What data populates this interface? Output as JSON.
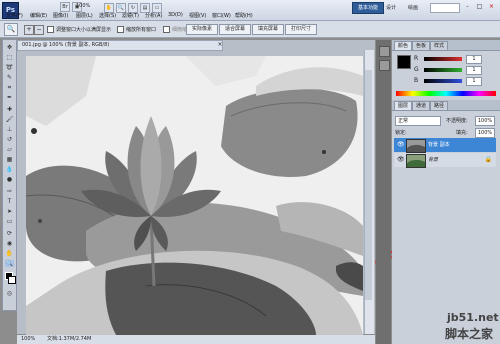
{
  "app": {
    "logo": "Ps",
    "zoom": "100%",
    "workspace_button": "基本功能",
    "workspace_menu_1": "设计",
    "workspace_menu_2": "绘画",
    "window_controls": [
      "-",
      "□",
      "×"
    ]
  },
  "menu": [
    "文件(F)",
    "编辑(E)",
    "图像(I)",
    "图层(L)",
    "选择(S)",
    "滤镜(T)",
    "分析(A)",
    "3D(D)",
    "视图(V)",
    "窗口(W)",
    "帮助(H)"
  ],
  "options": {
    "checkbox1": "调整窗口大小以满屏显示",
    "checkbox2": "缩放所有窗口",
    "checkbox3": "细微缩放",
    "buttons": [
      "实际像素",
      "适合屏幕",
      "填充屏幕",
      "打印尺寸"
    ]
  },
  "document": {
    "tab_title": "001.jpg @ 100% (背景 副本, RGB/8)",
    "status_zoom": "100%",
    "status_info": "文档:1.37M/2.74M"
  },
  "panels": {
    "color_tabs": [
      "颜色",
      "色板",
      "样式"
    ],
    "sliders": [
      {
        "label": "R",
        "value": "1",
        "color": "#e03030"
      },
      {
        "label": "G",
        "value": "1",
        "color": "#30b030"
      },
      {
        "label": "B",
        "value": "1",
        "color": "#3050e0"
      }
    ],
    "layer_tabs": [
      "图层",
      "通道",
      "路径"
    ],
    "blend_mode": "正常",
    "opacity_label": "不透明度:",
    "opacity_value": "100%",
    "lock_label": "锁定:",
    "fill_label": "填充:",
    "fill_value": "100%",
    "layers": [
      {
        "name": "背景 副本",
        "selected": true
      },
      {
        "name": "背景",
        "selected": false
      }
    ]
  },
  "watermark": {
    "url": "jb51.net",
    "cn": "脚本之家"
  }
}
